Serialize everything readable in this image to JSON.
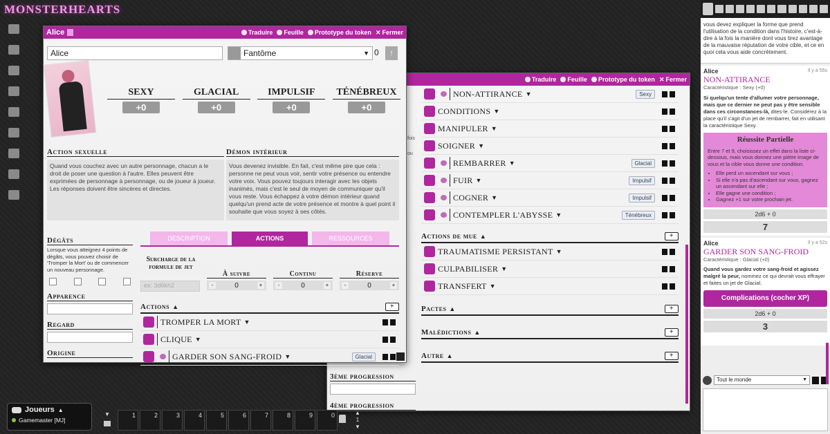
{
  "app": {
    "logo": "MONSTERHEARTS"
  },
  "sheet1": {
    "title": "Alice",
    "titlebar": {
      "translate": "Traduire",
      "sheet": "Feuille",
      "token": "Prototype du token",
      "close": "Fermer"
    },
    "name_value": "Alice",
    "skin_value": "Fantôme",
    "skin_count": "0",
    "stats": [
      {
        "name": "Sexy",
        "value": "+0"
      },
      {
        "name": "Glacial",
        "value": "+0"
      },
      {
        "name": "Impulsif",
        "value": "+0"
      },
      {
        "name": "Ténébreux",
        "value": "+0"
      }
    ],
    "sex_title": "Action sexuelle",
    "sex_text": "Quand vous couchez avec un autre personnage, chacun a le droit de poser une question à l'autre. Elles peuvent être exprimées de personnage à personnage, ou de joueur à joueur. Les réponses doivent être sincères et directes.",
    "demon_title": "Démon intérieur",
    "demon_text": "Vous devenez invisible. En fait, c'est même pire que cela : personne ne peut vous voir, sentir votre présence ou entendre votre voix. Vous pouvez toujours interagir avec les objets inanimés, mais c'est le seul de moyen de communiquer qu'il vous reste. Vous échappez à votre démon intérieur quand quelqu'un prend acte de votre présence et montre à quel point il souhaite que vous soyez à ses côtés.",
    "harm_title": "Dégâts",
    "harm_text": "Lorsque vous atteignez 4 points de dégâts, vous pouvez choisir de 'Tromper la Mort' ou de commencer un nouveau personnage.",
    "look_title": "Apparence",
    "eyes_title": "Regard",
    "origin_title": "Origine",
    "tabs": [
      "Description",
      "Actions",
      "Ressources"
    ],
    "override_label": "Surcharge de la formule de jet",
    "override_placeholder": "ex: 3d6kh2",
    "counters": [
      {
        "label": "À suivre",
        "value": "0"
      },
      {
        "label": "Continu",
        "value": "0"
      },
      {
        "label": "Réserve",
        "value": "0"
      }
    ],
    "actions_title": "Actions",
    "moves": [
      {
        "name": "Tromper la mort",
        "badge": ""
      },
      {
        "name": "Clique",
        "badge": ""
      },
      {
        "name": "Garder son sang-froid",
        "badge": "Glacial"
      }
    ]
  },
  "sheet2": {
    "titlebar": {
      "translate": "Traduire",
      "sheet": "Feuille",
      "token": "Prototype du token",
      "close": "Fermer"
    },
    "moves": [
      {
        "name": "Non-attirance",
        "badge": "Sexy"
      },
      {
        "name": "Conditions",
        "badge": ""
      },
      {
        "name": "Manipuler",
        "badge": ""
      },
      {
        "name": "Soigner",
        "badge": ""
      },
      {
        "name": "Rembarrer",
        "badge": "Glacial"
      },
      {
        "name": "Fuir",
        "badge": "Impulsif"
      },
      {
        "name": "Cogner",
        "badge": "Impulsif"
      },
      {
        "name": "Contempler l'abysse",
        "badge": "Ténébreux"
      }
    ],
    "mue_title": "Actions de mue",
    "mue_moves": [
      "Traumatisme persistant",
      "Culpabiliser",
      "Transfert"
    ],
    "pactes": "Pactes",
    "maledictions": "Malédictions",
    "autre": "Autre",
    "prog3": "3ème progression",
    "prog4": "4ème progression",
    "behind_text": [
      "fois",
      "ou"
    ]
  },
  "chat": {
    "top_text": "vous devez expliquer la forme que prend l'utilisation de la condition dans l'histoire, c'est-à-dire à la fois la manière dont vous tirez avantage de la mauvaise réputation de votre cible, et ce en quoi cela vous aide concrètement.",
    "msgs": [
      {
        "author": "Alice",
        "time": "Il y a 55s",
        "move": "Non-attirance",
        "stat": "Caractéristique : Sexy (+0)",
        "bold": "Si quelqu'un tente d'allumer votre personnage, mais que ce dernier ne peut pas y être sensible dans ces circonstances-là,",
        "text": " dites-le. Considérez à la place qu'il s'agit d'un jet de rembarrer, fait en utilisant la caractéristique Sexy.",
        "result_title": "Réussite Partielle",
        "result_text": "Entre 7 et 9, choisissez un effet dans la liste ci-dessous, mais vous donnez une piètre image de vous et la cible vous donne une condition.",
        "result_items": [
          "Elle perd un ascendant sur vous ;",
          "Si elle n'a pas d'ascendant sur vous, gagnez un ascendant sur elle ;",
          "Elle gagne une condition ;",
          "Gagnez +1 sur votre prochain jet."
        ],
        "formula": "2d6 + 0",
        "total": "7"
      },
      {
        "author": "Alice",
        "time": "Il y a 52s",
        "move": "Garder son sang-froid",
        "stat": "Caractéristique : Glacial (+0)",
        "bold": "Quand vous gardez votre sang-froid et agissez malgré la peur,",
        "text": " nommez ce qui devrait vous effrayer et faites un jet de Glacial.",
        "result_title": "Complications (cocher XP)",
        "formula": "2d6 + 0",
        "total": "3"
      }
    ],
    "speak_as": "Tout le monde"
  },
  "players": {
    "title": "Joueurs",
    "gm": "Gamemaster [MJ]"
  },
  "macros": [
    "1",
    "2",
    "3",
    "4",
    "5",
    "6",
    "7",
    "8",
    "9",
    "0"
  ],
  "page_num": "1",
  "icons": [
    "user-icon",
    "ruler-icon",
    "shapes-icon",
    "pencil-icon",
    "table-icon",
    "lightbulb-icon",
    "music-icon",
    "dice-icon",
    "bookmark-icon"
  ]
}
